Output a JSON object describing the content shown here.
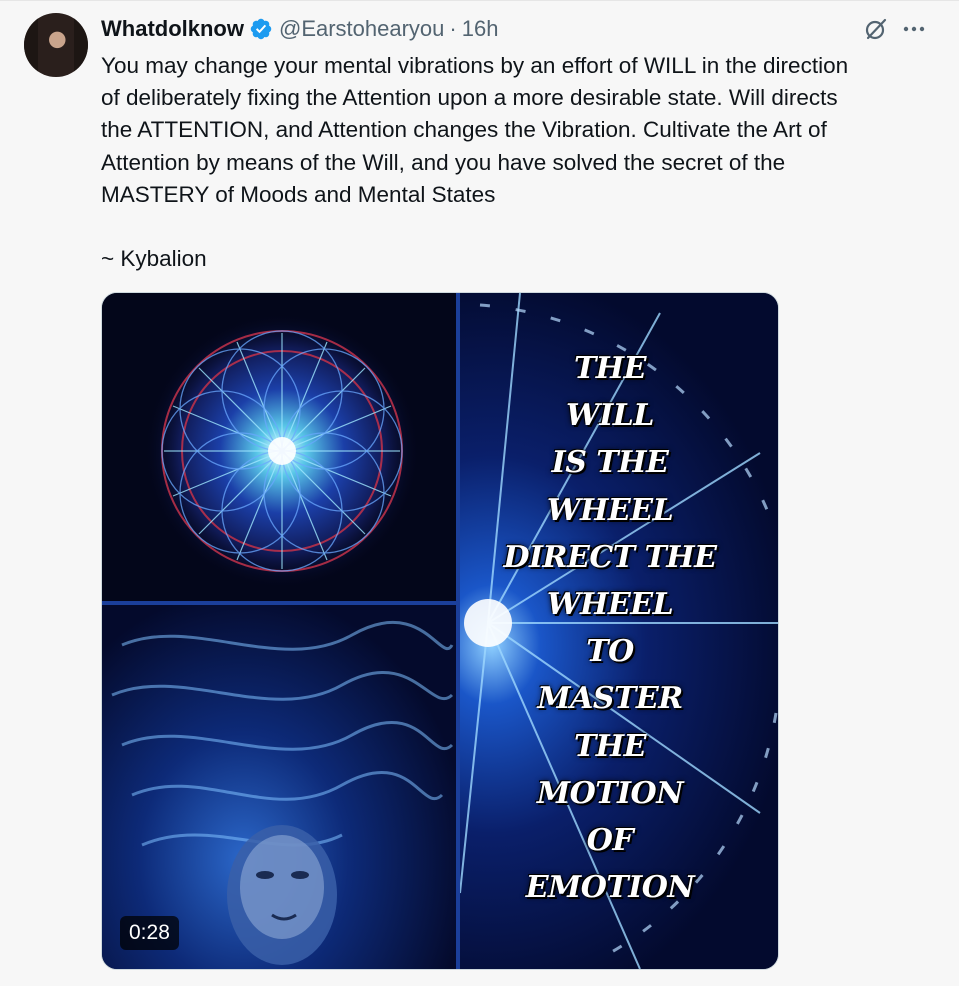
{
  "tweet": {
    "author_name": "Whatdolknow",
    "handle": "@Earstohearyou",
    "separator": "·",
    "time": "16h",
    "text": "You may change your mental vibrations by an effort of WILL in the direction\nof deliberately fixing the Attention upon a more desirable state. Will directs\nthe ATTENTION, and Attention changes the Vibration. Cultivate the Art of\nAttention by means of the Will, and you have solved the secret of the\nMASTERY of Moods and Mental States\n\n~ Kybalion"
  },
  "media": {
    "quote_lines": [
      "THE",
      "WILL",
      "IS THE",
      "WHEEL",
      "DIRECT THE",
      "WHEEL",
      "TO",
      "MASTER",
      "THE",
      "MOTION",
      "OF",
      "EMOTION"
    ],
    "duration": "0:28"
  },
  "icons": {
    "verified": "verified-badge-icon",
    "grok": "grok-icon",
    "more": "more-icon"
  },
  "colors": {
    "verified": "#1d9bf0",
    "secondary_text": "#536471",
    "background": "#f7f7f7"
  }
}
